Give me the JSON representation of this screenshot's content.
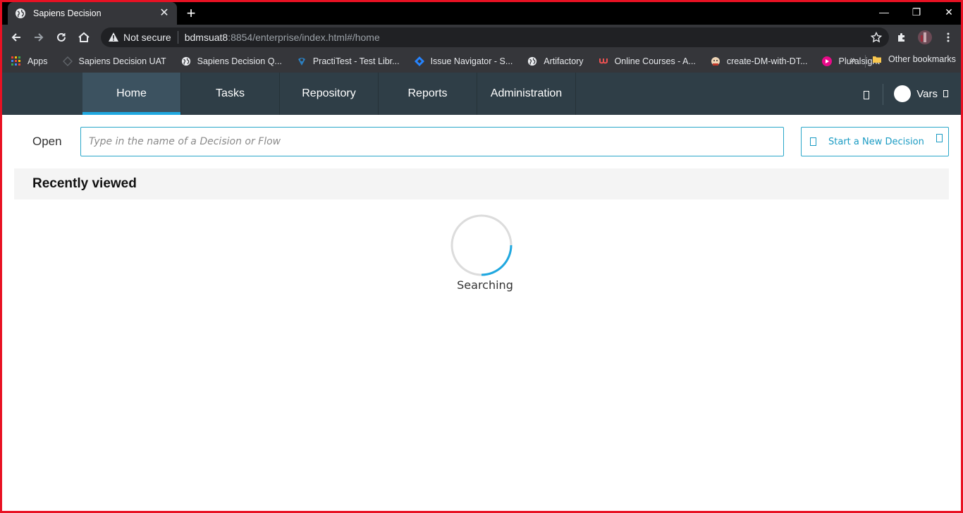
{
  "browser": {
    "tab_title": "Sapiens Decision",
    "tab_close": "✕",
    "new_tab": "+",
    "window_controls": {
      "minimize": "—",
      "restore": "❐",
      "close": "✕"
    },
    "security_label": "Not secure",
    "url_host": "bdmsuat8",
    "url_rest": ":8854/enterprise/index.html#/home"
  },
  "bookmarks": {
    "items": [
      {
        "label": "Apps",
        "icon": "apps-grid-icon"
      },
      {
        "label": "Sapiens Decision UAT",
        "icon": "sapiens-icon"
      },
      {
        "label": "Sapiens Decision Q...",
        "icon": "globe-icon"
      },
      {
        "label": "PractiTest - Test Libr...",
        "icon": "practitest-icon"
      },
      {
        "label": "Issue Navigator - S...",
        "icon": "jira-icon"
      },
      {
        "label": "Artifactory",
        "icon": "globe-icon"
      },
      {
        "label": "Online Courses - A...",
        "icon": "udemy-icon"
      },
      {
        "label": "create-DM-with-DT...",
        "icon": "jenkins-icon"
      },
      {
        "label": "Pluralsight",
        "icon": "pluralsight-icon"
      }
    ],
    "more": "»",
    "other_label": "Other bookmarks"
  },
  "nav": {
    "tabs": [
      {
        "label": "Home"
      },
      {
        "label": "Tasks"
      },
      {
        "label": "Repository"
      },
      {
        "label": "Reports"
      },
      {
        "label": "Administration"
      }
    ],
    "active_tab": "Home",
    "user_name": "Vars"
  },
  "main": {
    "open_label": "Open",
    "search_placeholder": "Type in the name of a Decision or Flow",
    "new_decision_label": "Start a New Decision",
    "recent_title": "Recently viewed",
    "status": "Searching"
  },
  "colors": {
    "accent": "#1fa8e0",
    "nav_bg": "#2f3e47",
    "window_border": "#e81123"
  }
}
